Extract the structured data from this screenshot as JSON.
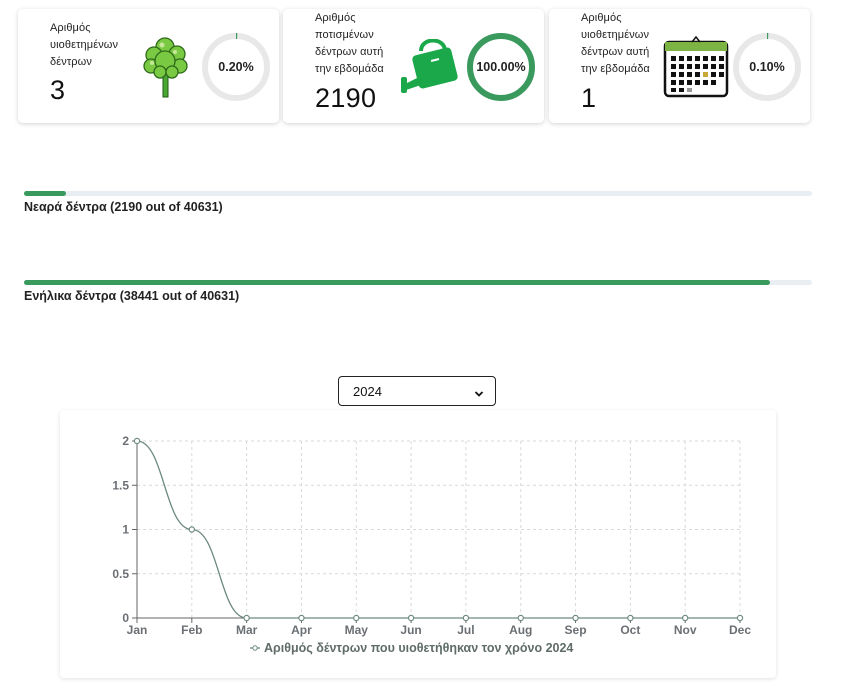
{
  "colors": {
    "accent": "#3a9a5e",
    "ring_track": "#e8e8e8",
    "tree_green": "#5bbf3a",
    "can_green": "#1aa84a",
    "calendar_green": "#7cb342",
    "line": "#6e8a82",
    "grid": "#d9d9d9"
  },
  "stats": [
    {
      "label": "Αριθμός\nυιοθετημένων\nδέντρων",
      "value": "3",
      "percent_text": "0.20%",
      "percent": 0.2,
      "icon": "tree-icon"
    },
    {
      "label": "Αριθμός\nποτισμένων\nδέντρων αυτή\nτην εβδομάδα",
      "value": "2190",
      "percent_text": "100.00%",
      "percent": 100,
      "icon": "watering-can-icon"
    },
    {
      "label": "Αριθμός\nυιοθετημένων\nδέντρων αυτή\nτην εβδομάδα",
      "value": "1",
      "percent_text": "0.10%",
      "percent": 0.1,
      "icon": "calendar-icon"
    }
  ],
  "progress": [
    {
      "label": "Νεαρά δέντρα (2190 out of 40631)",
      "value": 2190,
      "total": 40631
    },
    {
      "label": "Ενήλικα δέντρα (38441 out of 40631)",
      "value": 38441,
      "total": 40631
    }
  ],
  "year_select": {
    "selected": "2024",
    "icon": "chevron-down-icon"
  },
  "chart_data": {
    "type": "line",
    "categories": [
      "Jan",
      "Feb",
      "Mar",
      "Apr",
      "May",
      "Jun",
      "Jul",
      "Aug",
      "Sep",
      "Oct",
      "Nov",
      "Dec"
    ],
    "series": [
      {
        "name": "Αριθμός δέντρων που υιοθετήθηκαν τον χρόνο 2024",
        "values": [
          2,
          1,
          0,
          0,
          0,
          0,
          0,
          0,
          0,
          0,
          0,
          0
        ]
      }
    ],
    "yticks": [
      "0",
      "0.5",
      "1",
      "1.5",
      "2"
    ],
    "ylim": [
      0,
      2
    ],
    "grid": true,
    "legend": "bottom"
  }
}
